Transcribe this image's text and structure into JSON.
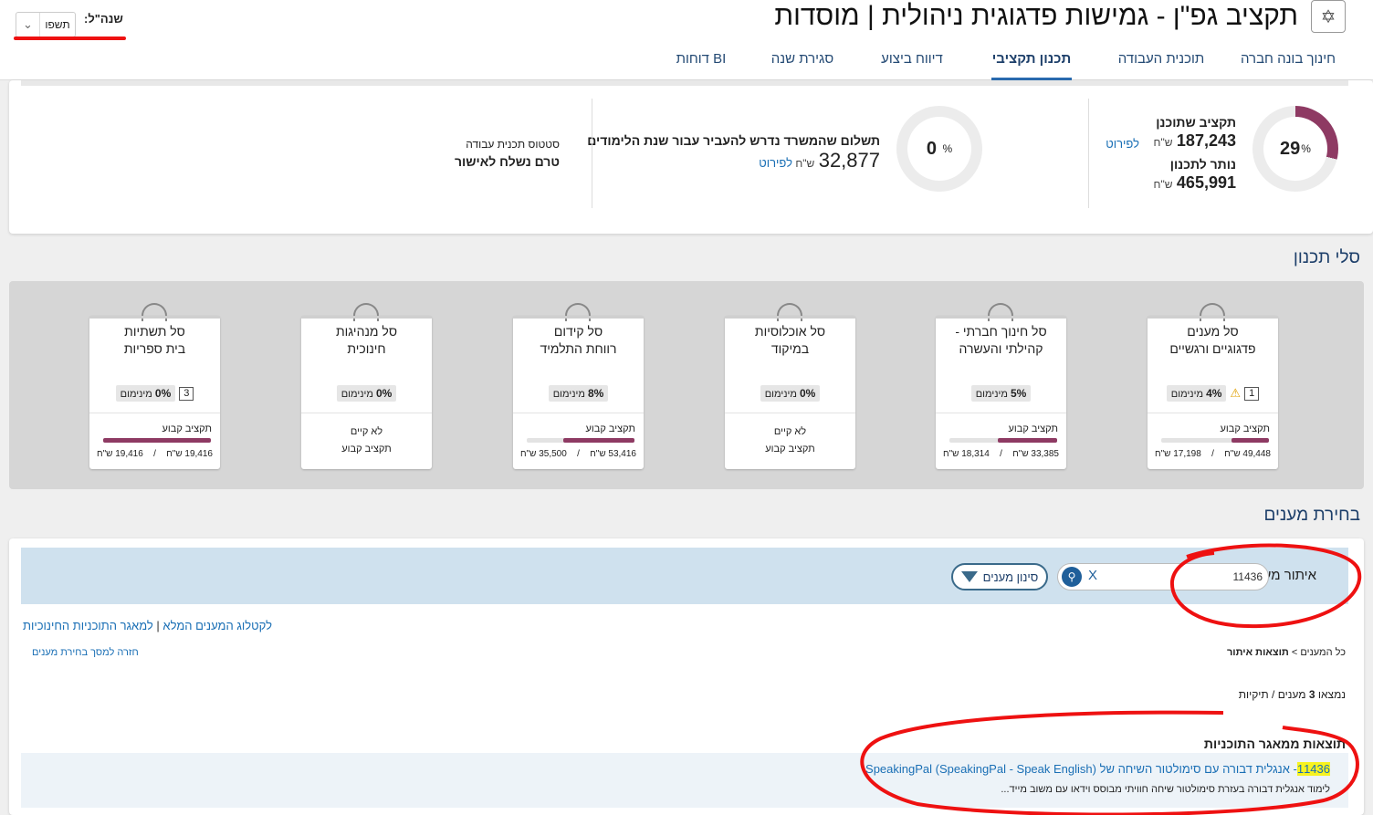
{
  "header": {
    "title": "תקציב גפ\"ן - גמישות פדגוגית ניהולית | מוסדות",
    "year_label": "שנה\"ל:",
    "year_value": "תשפו",
    "tabs": [
      {
        "label": "חינוך בונה חברה",
        "active": false
      },
      {
        "label": "תוכנית העבודה",
        "active": false
      },
      {
        "label": "תכנון תקציבי",
        "active": true
      },
      {
        "label": "דיווח ביצוע",
        "active": false
      },
      {
        "label": "סגירת שנה",
        "active": false
      },
      {
        "label": "דוחות BI",
        "active": false
      }
    ]
  },
  "summary": {
    "budget_percent": "29",
    "budget_percent_value": 0.29,
    "budget_planned_label": "תקציב שתוכנן",
    "budget_planned_value": "187,243",
    "remaining_label": "נותר לתכנון",
    "remaining_value": "465,991",
    "currency": "ש\"ח",
    "details_link": "לפירוט",
    "payment_percent": "0",
    "payment_label": "תשלום שהמשרד נדרש להעביר עבור שנת הלימודים",
    "payment_value": "32,877",
    "percent_sign": "%",
    "status_label": "סטטוס תכנית עבודה",
    "status_value": "טרם נשלח לאישור"
  },
  "baskets_heading": "סלי תכנון",
  "baskets": [
    {
      "name1": "סל מענים",
      "name2": "פדגוגיים ורגשיים",
      "min": "4%",
      "min_label": "מינימום",
      "warn": true,
      "count": "1",
      "fixed_label": "תקציב קבוע",
      "total": "49,448",
      "used": "17,198",
      "progress": 0.35,
      "exists": true
    },
    {
      "name1": "סל חינוך חברתי -",
      "name2": "קהילתי והעשרה",
      "min": "5%",
      "min_label": "מינימום",
      "warn": false,
      "count": "",
      "fixed_label": "תקציב קבוע",
      "total": "33,385",
      "used": "18,314",
      "progress": 0.55,
      "exists": true
    },
    {
      "name1": "סל אוכלוסיות",
      "name2": "במיקוד",
      "min": "0%",
      "min_label": "מינימום",
      "warn": false,
      "count": "",
      "no_exist": "לא קיים",
      "fixed_label": "תקציב קבוע",
      "exists": false
    },
    {
      "name1": "סל קידום",
      "name2": "רווחת התלמיד",
      "min": "8%",
      "min_label": "מינימום",
      "warn": false,
      "count": "",
      "fixed_label": "תקציב קבוע",
      "total": "53,416",
      "used": "35,500",
      "progress": 0.66,
      "exists": true
    },
    {
      "name1": "סל מנהיגות",
      "name2": "חינוכית",
      "min": "0%",
      "min_label": "מינימום",
      "warn": false,
      "count": "",
      "no_exist": "לא קיים",
      "fixed_label": "תקציב קבוע",
      "exists": false
    },
    {
      "name1": "סל תשתיות",
      "name2": "בית ספריות",
      "min": "0%",
      "min_label": "מינימום",
      "warn": false,
      "count": "3",
      "fixed_label": "תקציב קבוע",
      "total": "19,416",
      "used": "19,416",
      "progress": 1.0,
      "exists": true
    }
  ],
  "currency_short": "ש\"ח",
  "search_heading": "בחירת מענים",
  "search": {
    "label": "איתור מענה",
    "value": "11436",
    "clear": "X",
    "filter_label": "סינון מענים",
    "catalog_link": "לקטלוג המענים המלא",
    "pool_link": "למאגר התוכניות החינוכיות",
    "crumb_all": "כל המענים",
    "crumb_current": "תוצאות איתור",
    "back_link": "חזרה למסך בחירת מענים",
    "found_prefix": "נמצאו",
    "found_count": "3",
    "found_suffix": "מענים / תיקיות",
    "results_heading": "תוצאות ממאגר התוכניות",
    "result_id": "11436",
    "result_title": "- אנגלית דבורה עם סימולטור השיחה של SpeakingPal (SpeakingPal - Speak English)",
    "result_desc": "לימוד אנגלית דבורה בעזרת סימולטור שיחה חוויתי מבוסס וידאו עם משוב מייד..."
  }
}
